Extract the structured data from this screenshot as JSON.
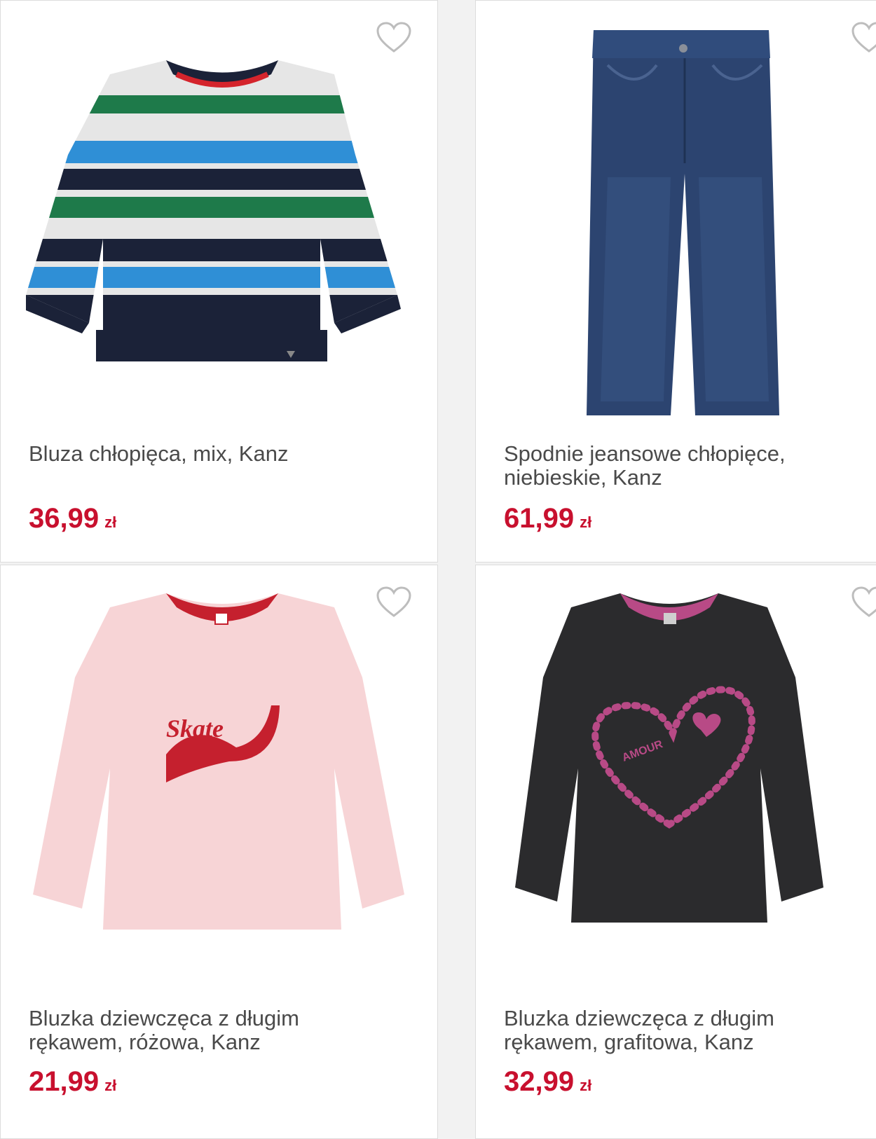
{
  "products": [
    {
      "title": "Bluza chłopięca, mix, Kanz",
      "price": "36,99",
      "currency": "zł",
      "image": "striped-sweatshirt-image"
    },
    {
      "title": "Spodnie jeansowe chłopięce, niebieskie, Kanz",
      "price": "61,99",
      "currency": "zł",
      "image": "jeans-image"
    },
    {
      "title": "Bluzka dziewczęca z długim rękawem, różowa, Kanz",
      "price": "21,99",
      "currency": "zł",
      "image": "pink-longsleeve-image",
      "print_text": "Skate"
    },
    {
      "title": "Bluzka dziewczęca z długim rękawem, grafitowa, Kanz",
      "price": "32,99",
      "currency": "zł",
      "image": "graphite-longsleeve-image",
      "print_text": "AMOUR"
    }
  ],
  "favorite_icon": "heart-outline-icon",
  "colors": {
    "price": "#c8102e",
    "title": "#4a4a4a",
    "border": "#dcdcdc"
  }
}
